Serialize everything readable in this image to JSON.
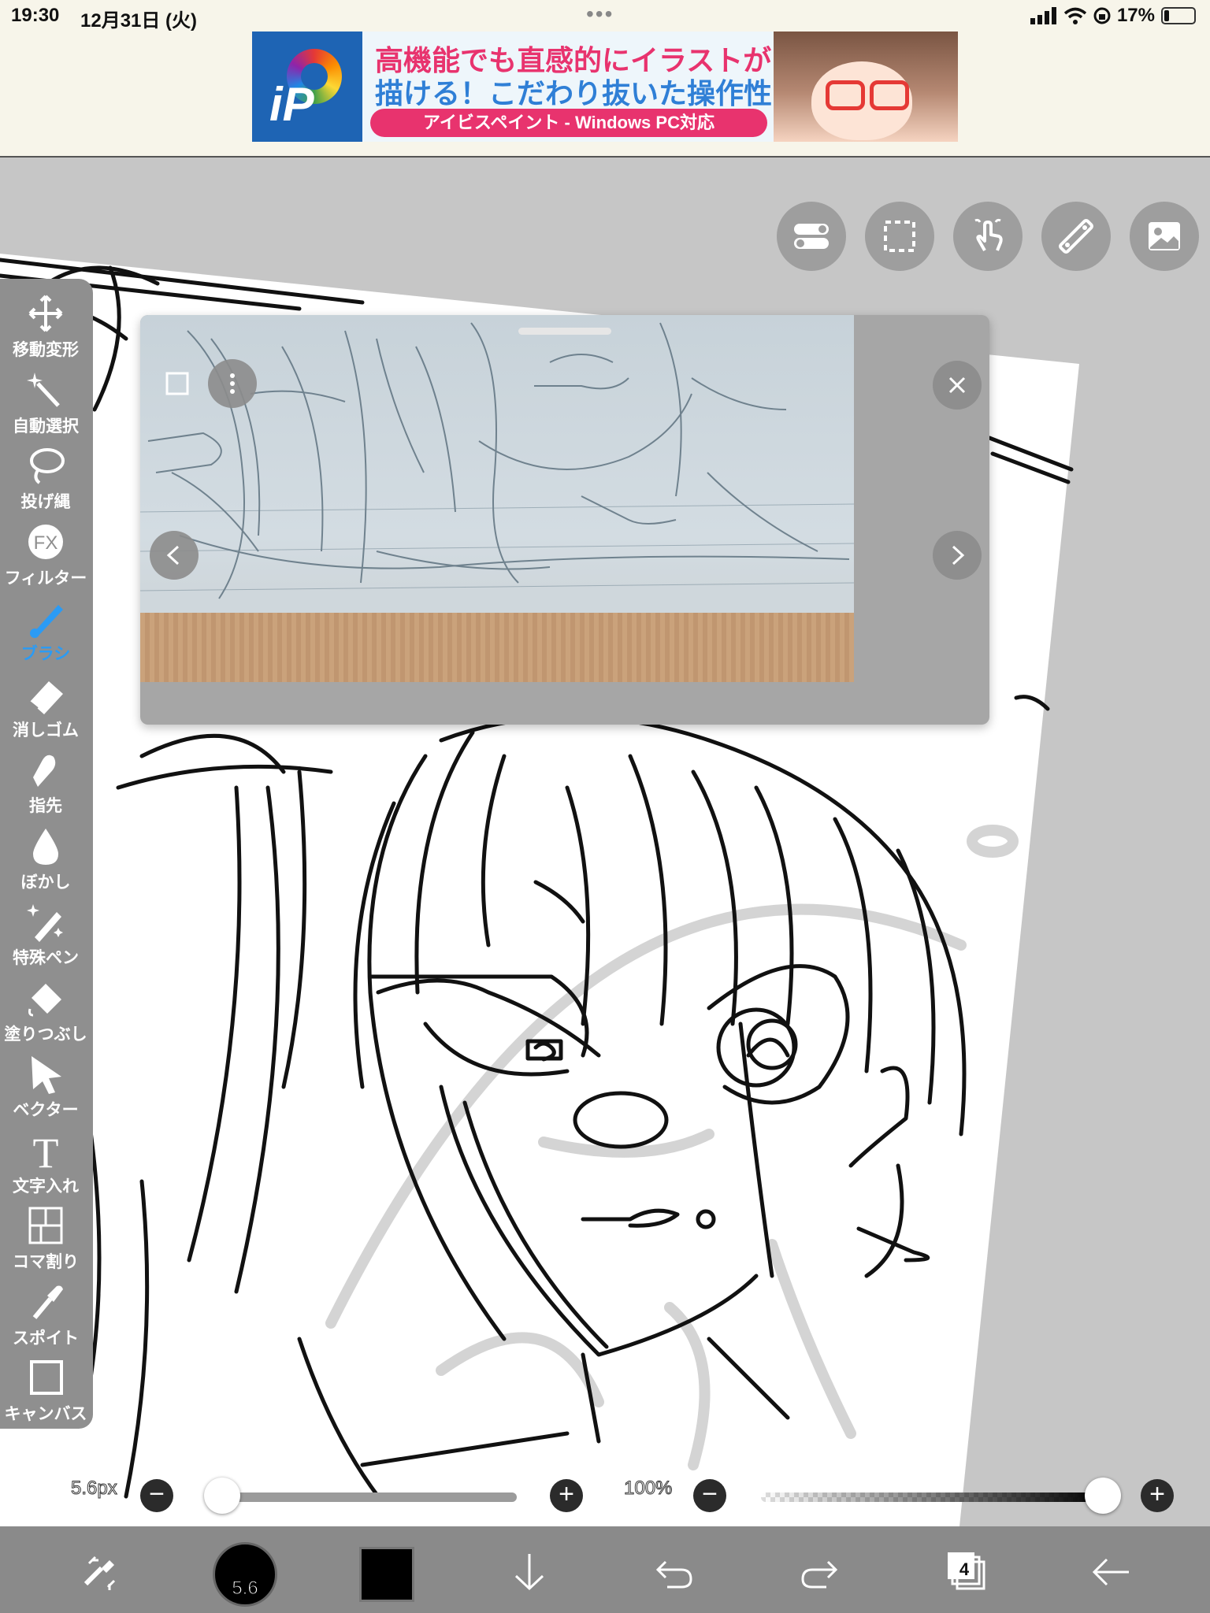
{
  "status_bar": {
    "time": "19:30",
    "date": "12月31日 (火)",
    "battery_percent": "17%",
    "multitask_dots": "•••"
  },
  "ad": {
    "logo_text": "iP",
    "headline_1": "高機能でも直感的にイラストが",
    "headline_2": "描ける！こだわり抜いた操作性！",
    "tagline": "アイビスペイント - Windows PC対応"
  },
  "top_icons": [
    "toggle-icon",
    "selection-icon",
    "gesture-icon",
    "ruler-icon",
    "material-icon"
  ],
  "tools": [
    {
      "name": "transform",
      "label": "移動変形",
      "icon": "move-arrows-icon",
      "active": false
    },
    {
      "name": "magic-wand",
      "label": "自動選択",
      "icon": "magic-wand-icon",
      "active": false
    },
    {
      "name": "lasso",
      "label": "投げ縄",
      "icon": "lasso-icon",
      "active": false
    },
    {
      "name": "filter",
      "label": "フィルター",
      "icon": "fx-icon",
      "active": false
    },
    {
      "name": "brush",
      "label": "ブラシ",
      "icon": "brush-icon",
      "active": true
    },
    {
      "name": "eraser",
      "label": "消しゴム",
      "icon": "eraser-icon",
      "active": false
    },
    {
      "name": "smudge",
      "label": "指先",
      "icon": "smudge-icon",
      "active": false
    },
    {
      "name": "blur",
      "label": "ぼかし",
      "icon": "blur-drop-icon",
      "active": false
    },
    {
      "name": "special-pen",
      "label": "特殊ペン",
      "icon": "special-pen-icon",
      "active": false
    },
    {
      "name": "fill",
      "label": "塗りつぶし",
      "icon": "fill-bucket-icon",
      "active": false
    },
    {
      "name": "vector",
      "label": "ベクター",
      "icon": "vector-arrow-icon",
      "active": false
    },
    {
      "name": "text",
      "label": "文字入れ",
      "icon": "text-icon",
      "active": false
    },
    {
      "name": "frame-divider",
      "label": "コマ割り",
      "icon": "panel-icon",
      "active": false
    },
    {
      "name": "eyedropper",
      "label": "スポイト",
      "icon": "eyedropper-icon",
      "active": false
    },
    {
      "name": "canvas",
      "label": "キャンバス",
      "icon": "canvas-icon",
      "active": false
    }
  ],
  "sliders": {
    "brush_size_label": "5.6px",
    "brush_size_fraction": 0.05,
    "opacity_label": "100%",
    "opacity_fraction": 1.0,
    "minus": "−",
    "plus": "+"
  },
  "bottom_bar": {
    "brush_size_value": "5.6",
    "layer_count": "4",
    "color": "#000000"
  },
  "colors": {
    "accent": "#2b9bf4",
    "toolbar_bg": "#8f8f8f",
    "workspace_bg": "#c6c6c6",
    "bottom_bar_bg": "#8a8a8a",
    "ad_pink": "#e8336e",
    "ad_blue": "#2f7fd6"
  }
}
